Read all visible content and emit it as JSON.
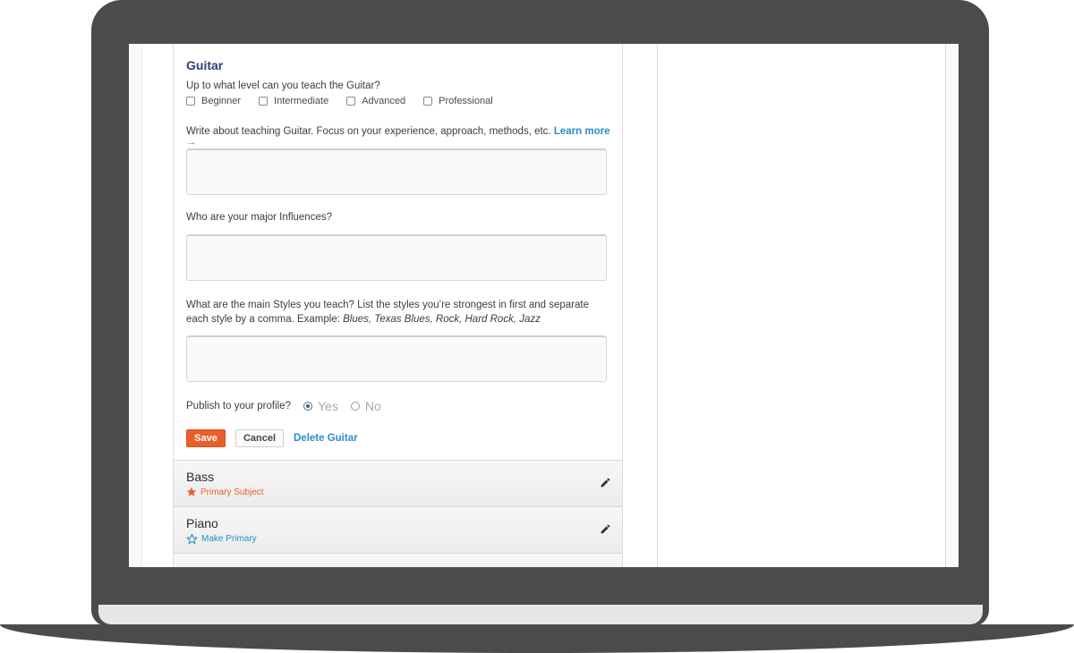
{
  "subject": {
    "title": "Guitar",
    "level_question": "Up to what level can you teach the Guitar?",
    "levels": [
      "Beginner",
      "Intermediate",
      "Advanced",
      "Professional"
    ],
    "about_prompt": "Write about teaching Guitar. Focus on your experience, approach, methods, etc.",
    "learn_more": "Learn more →",
    "influences_prompt": "Who are your major Influences?",
    "styles_prompt": "What are the main Styles you teach? List the styles you’re strongest in first and separate each style by a comma. Example:",
    "styles_example": "Blues, Texas Blues, Rock, Hard Rock, Jazz",
    "publish_label": "Publish to your profile?",
    "publish_yes": "Yes",
    "publish_no": "No",
    "publish_selected": "Yes",
    "save_label": "Save",
    "cancel_label": "Cancel",
    "delete_label": "Delete Guitar"
  },
  "other_subjects": [
    {
      "name": "Bass",
      "status": "Primary Subject",
      "status_icon": "star-filled-icon",
      "status_color": "#e9602b"
    },
    {
      "name": "Piano",
      "status": "Make Primary",
      "status_icon": "star-outline-icon",
      "status_color": "#2a8fc6"
    }
  ],
  "colors": {
    "accent": "#e9602b",
    "link": "#2a8fc6",
    "title": "#24476e"
  }
}
